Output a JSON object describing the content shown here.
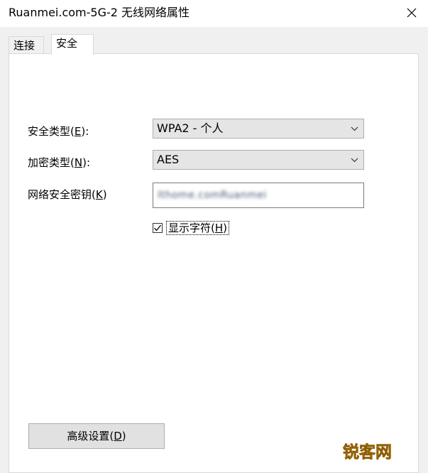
{
  "window": {
    "title": "Ruanmei.com-5G-2 无线网络属性",
    "close_icon": "close-icon"
  },
  "tabs": [
    {
      "label": "连接",
      "active": false
    },
    {
      "label": "安全",
      "active": true
    }
  ],
  "security": {
    "security_type": {
      "label_prefix": "安全类型(",
      "label_key": "E",
      "label_suffix": "):",
      "value": "WPA2 - 个人"
    },
    "encryption_type": {
      "label_prefix": "加密类型(",
      "label_key": "N",
      "label_suffix": "):",
      "value": "AES"
    },
    "network_key": {
      "label_prefix": "网络安全密钥(",
      "label_key": "K",
      "label_suffix": ")",
      "value": "Ithome.comRuanmei"
    },
    "show_characters": {
      "label_prefix": "显示字符(",
      "label_key": "H",
      "label_suffix": ")",
      "checked": true
    }
  },
  "advanced_button": {
    "label_prefix": "高级设置(",
    "label_key": "D",
    "label_suffix": ")"
  },
  "watermark": {
    "text": "锐客网",
    "color": "#e8a000"
  }
}
